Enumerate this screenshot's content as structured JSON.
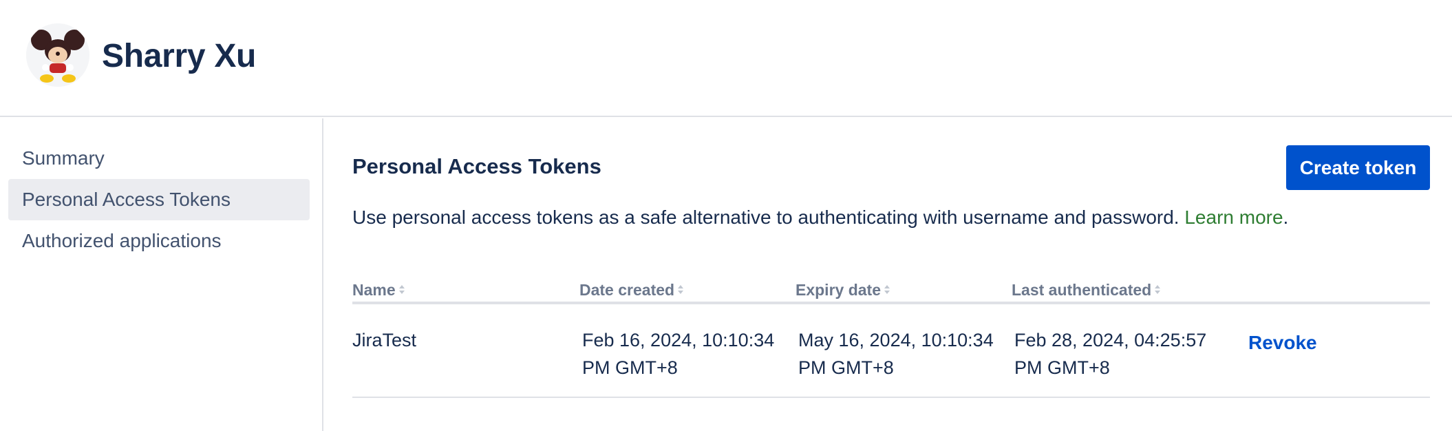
{
  "header": {
    "user_name": "Sharry Xu"
  },
  "sidebar": {
    "items": [
      {
        "label": "Summary",
        "active": false
      },
      {
        "label": "Personal Access Tokens",
        "active": true
      },
      {
        "label": "Authorized applications",
        "active": false
      }
    ]
  },
  "main": {
    "title": "Personal Access Tokens",
    "create_button": "Create token",
    "description": "Use personal access tokens as a safe alternative to authenticating with username and password.",
    "learn_more": "Learn more",
    "description_suffix": ".",
    "table": {
      "columns": [
        "Name",
        "Date created",
        "Expiry date",
        "Last authenticated"
      ],
      "rows": [
        {
          "name": "JiraTest",
          "date_created": "Feb 16, 2024, 10:10:34 PM GMT+8",
          "expiry_date": "May 16, 2024, 10:10:34 PM GMT+8",
          "last_authenticated": "Feb 28, 2024, 04:25:57 PM GMT+8",
          "action": "Revoke"
        }
      ]
    }
  },
  "colors": {
    "primary": "#0052cc",
    "link_green": "#2e7d32",
    "text": "#172b4d",
    "muted": "#6b778c",
    "border": "#dfe1e6",
    "active_bg": "#ebecf0"
  }
}
